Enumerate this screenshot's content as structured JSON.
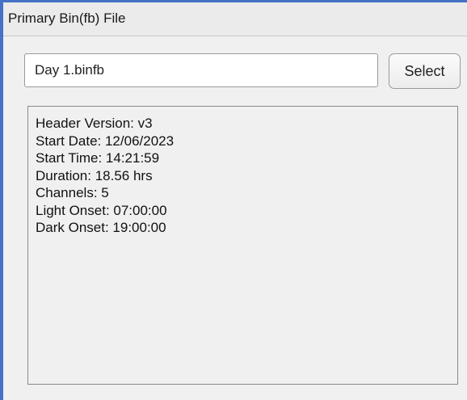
{
  "panel": {
    "title": "Primary Bin(fb) File"
  },
  "file": {
    "value": "Day 1.binfb"
  },
  "select_button": {
    "label": "Select"
  },
  "header_info": {
    "lines": [
      "Header Version: v3",
      "Start Date: 12/06/2023",
      "Start Time: 14:21:59",
      "Duration: 18.56 hrs",
      "Channels: 5",
      "Light Onset: 07:00:00",
      "Dark Onset: 19:00:00"
    ]
  },
  "colors": {
    "frame_accent": "#4472c4",
    "panel_background": "#f0f0f0",
    "header_background": "#ebebeb"
  }
}
